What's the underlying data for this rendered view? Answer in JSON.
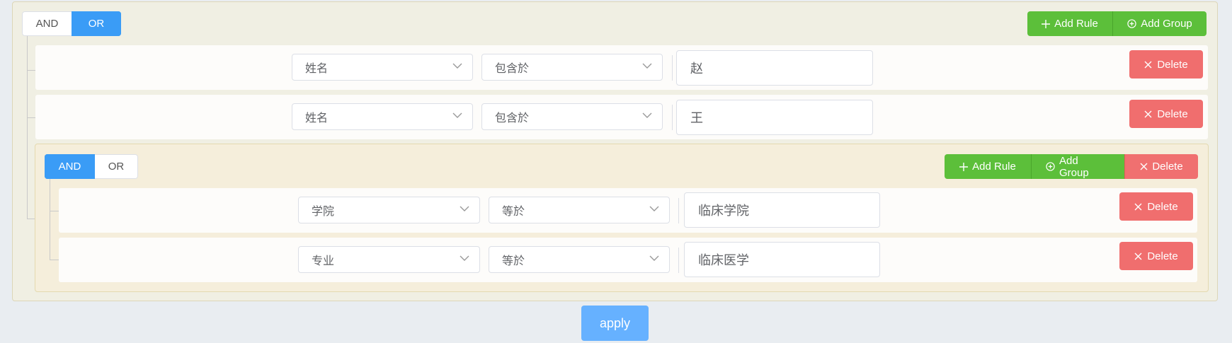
{
  "outer_group": {
    "toggle": {
      "and_label": "AND",
      "or_label": "OR",
      "selected": "OR"
    },
    "add_rule_label": "Add Rule",
    "add_group_label": "Add Group",
    "rules": [
      {
        "field": "姓名",
        "operator": "包含於",
        "value": "赵",
        "delete_label": "Delete"
      },
      {
        "field": "姓名",
        "operator": "包含於",
        "value": "王",
        "delete_label": "Delete"
      }
    ]
  },
  "inner_group": {
    "toggle": {
      "and_label": "AND",
      "or_label": "OR",
      "selected": "AND"
    },
    "add_rule_label": "Add Rule",
    "add_group_label": "Add Group",
    "delete_label": "Delete",
    "rules": [
      {
        "field": "学院",
        "operator": "等於",
        "value": "临床学院",
        "delete_label": "Delete"
      },
      {
        "field": "专业",
        "operator": "等於",
        "value": "临床医学",
        "delete_label": "Delete"
      }
    ]
  },
  "apply_label": "apply",
  "icons": {
    "plus": "plus-icon",
    "add_circle": "circle-plus-icon",
    "close": "close-icon",
    "dropdown": "chevron-down-icon"
  },
  "colors": {
    "primary": "#3a9cf6",
    "success": "#5cbf3a",
    "danger": "#f06e6e",
    "apply": "#66b1ff"
  }
}
